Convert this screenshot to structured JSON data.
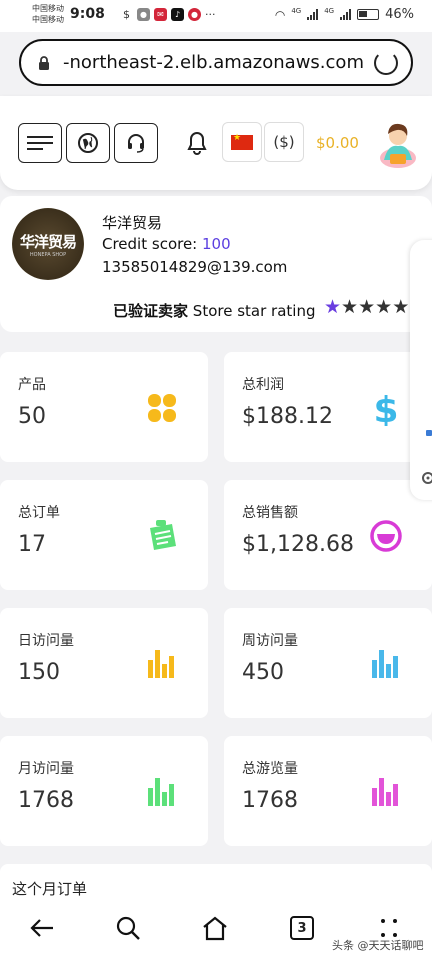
{
  "status_bar": {
    "carrier1": "中国移动",
    "carrier2": "中国移动",
    "time": "9:08",
    "network1": "4G",
    "network2": "4G",
    "battery": "46%"
  },
  "url_bar": {
    "url": "-northeast-2.elb.amazonaws.com"
  },
  "header": {
    "currency_label": "($)",
    "balance": "$0.00"
  },
  "shop": {
    "logo_text": "华洋贸易",
    "logo_sub": "HONEPA SHOP",
    "name": "华洋贸易",
    "credit_label": "Credit score: ",
    "credit_value": "100",
    "email": "13585014829@139.com",
    "verified_label": "已验证卖家",
    "rating_label": "Store star rating",
    "stars_filled": 1,
    "stars_total": 5
  },
  "stats": [
    {
      "label": "产品",
      "value": "50",
      "icon": "clover-icon",
      "color": "#f6b91b"
    },
    {
      "label": "总利润",
      "value": "$188.12",
      "icon": "dollar-icon",
      "color": "#3bb8e8"
    },
    {
      "label": "总订单",
      "value": "17",
      "icon": "note-icon",
      "color": "#5ce07a"
    },
    {
      "label": "总销售额",
      "value": "$1,128.68",
      "icon": "smile-icon",
      "color": "#d83bd6"
    },
    {
      "label": "日访问量",
      "value": "150",
      "icon": "bar-chart-icon",
      "color": "#f6b91b"
    },
    {
      "label": "周访问量",
      "value": "450",
      "icon": "bar-chart-icon",
      "color": "#49b8ea"
    },
    {
      "label": "月访问量",
      "value": "1768",
      "icon": "bar-chart-icon",
      "color": "#5ce07a"
    },
    {
      "label": "总游览量",
      "value": "1768",
      "icon": "bar-chart-icon",
      "color": "#e254d8"
    }
  ],
  "section": {
    "this_month_orders": "这个月订单"
  },
  "nav": {
    "tab_count": "3"
  },
  "watermark": "头条 @天天话聊吧"
}
